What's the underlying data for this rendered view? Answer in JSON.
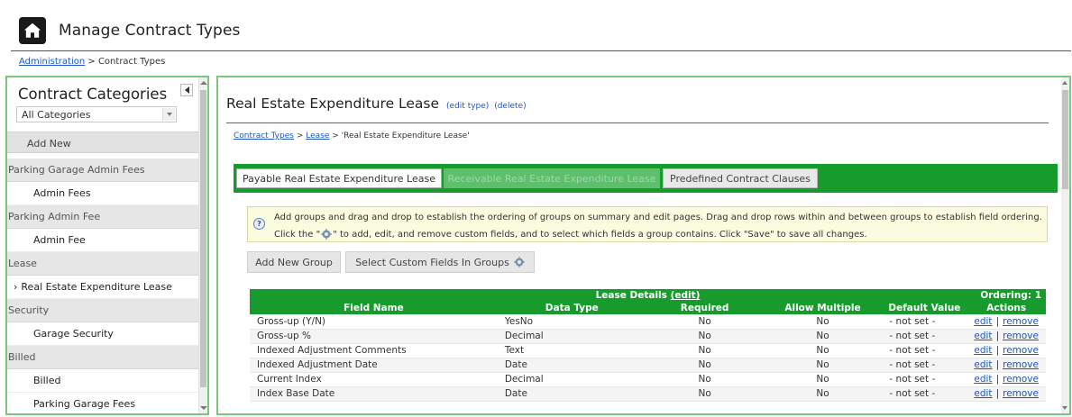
{
  "header": {
    "title": "Manage Contract Types",
    "breadcrumb": {
      "link": "Administration",
      "separator": ">",
      "current": "Contract Types"
    }
  },
  "sidebar": {
    "heading": "Contract Categories",
    "filter_value": "All Categories",
    "add_new_label": "Add New",
    "categories": [
      {
        "group": "Parking Garage Admin Fees",
        "items": [
          "Admin Fees"
        ]
      },
      {
        "group": "Parking Admin Fee",
        "items": [
          "Admin Fee"
        ]
      },
      {
        "group": "Lease",
        "items": [
          "Real Estate Expenditure Lease"
        ]
      },
      {
        "group": "Security",
        "items": [
          "Garage Security"
        ]
      },
      {
        "group": "Billed",
        "items": [
          "Billed",
          "Parking Garage Fees"
        ]
      }
    ],
    "active_item": "Real Estate Expenditure Lease"
  },
  "content": {
    "title": "Real Estate Expenditure Lease",
    "edit_type_label": "(edit type)",
    "delete_label": "(delete)",
    "breadcrumb": {
      "link1": "Contract Types",
      "sep1": ">",
      "link2": "Lease",
      "sep2": ">",
      "current": "'Real Estate Expenditure Lease'"
    },
    "tabs": [
      {
        "label": "Payable Real Estate Expenditure Lease",
        "state": "selected"
      },
      {
        "label": "Receivable Real Estate Expenditure Lease",
        "state": "disabled"
      },
      {
        "label": "Predefined Contract Clauses",
        "state": "normal"
      }
    ],
    "info": {
      "line1": "Add groups and drag and drop to establish the ordering of groups on summary and edit pages. Drag and drop rows within and between groups to establish field ordering.",
      "line2_before": "Click the \"",
      "line2_after": "\" to add, edit, and remove custom fields, and to select which fields a group contains. Click \"Save\" to save all changes."
    },
    "buttons": {
      "add_group": "Add New Group",
      "select_fields": "Select Custom Fields In Groups"
    },
    "table": {
      "caption": "Lease Details",
      "caption_edit": "(edit)",
      "ordering": "Ordering: 1",
      "columns": [
        "Field Name",
        "Data Type",
        "Required",
        "Allow Multiple",
        "Default Value",
        "Actions"
      ],
      "edit_label": "edit",
      "action_sep": "|",
      "remove_label": "remove",
      "rows": [
        {
          "field": "Gross-up (Y/N)",
          "type": "YesNo",
          "required": "No",
          "multiple": "No",
          "default": "- not set -"
        },
        {
          "field": "Gross-up %",
          "type": "Decimal",
          "required": "No",
          "multiple": "No",
          "default": "- not set -"
        },
        {
          "field": "Indexed Adjustment Comments",
          "type": "Text",
          "required": "No",
          "multiple": "No",
          "default": "- not set -"
        },
        {
          "field": "Indexed Adjustment Date",
          "type": "Date",
          "required": "No",
          "multiple": "No",
          "default": "- not set -"
        },
        {
          "field": "Current Index",
          "type": "Decimal",
          "required": "No",
          "multiple": "No",
          "default": "- not set -"
        },
        {
          "field": "Index Base Date",
          "type": "Date",
          "required": "No",
          "multiple": "No",
          "default": "- not set -"
        }
      ]
    }
  },
  "colors": {
    "accent_green": "#179b2d",
    "panel_border": "#7dc67d",
    "link": "#1a56c4"
  }
}
